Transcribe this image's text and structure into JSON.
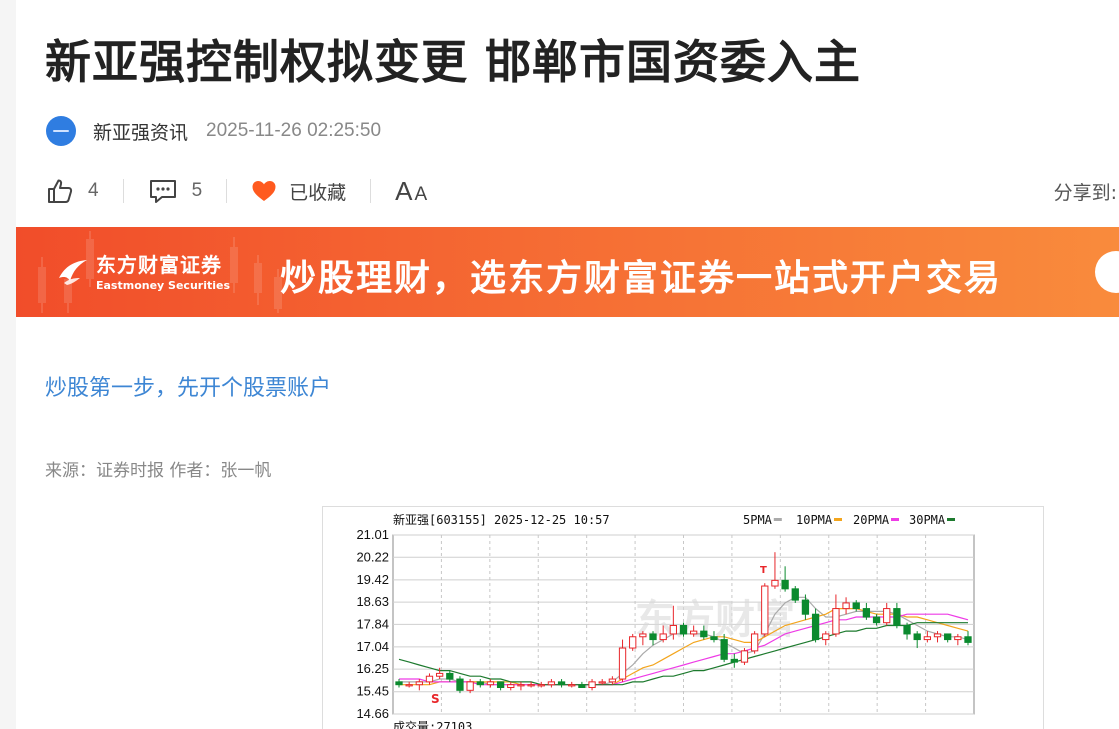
{
  "article": {
    "title": "新亚强控制权拟变更 邯郸市国资委入主",
    "source_name": "新亚强资讯",
    "publish_time": "2025-11-26 02:25:50",
    "like_count": "4",
    "comment_count": "5",
    "favorite_label": "已收藏",
    "font_size_big": "A",
    "font_size_small": "A",
    "share_label": "分享到:",
    "promo_link": "炒股第一步，先开个股票账户",
    "origin": "来源：证券时报 作者：张一帆"
  },
  "banner": {
    "brand_cn": "东方财富证券",
    "brand_en": "Eastmoney Securities",
    "slogan": "炒股理财，选东方财富证券一站式开户交易"
  },
  "colors": {
    "banner_start": "#f14d2a",
    "banner_end": "#f98b3c",
    "link": "#3d86d4",
    "favorite_heart": "#ff5a1f",
    "candle_up": "#e8262a",
    "candle_down": "#0b8a2e",
    "ma5": "#aaaaaa",
    "ma10": "#f3a51d",
    "ma20": "#ee3be6",
    "ma30": "#1d7a2e"
  },
  "icons": {
    "like": "thumbs-up-icon",
    "comment": "comment-icon",
    "favorite": "heart-icon"
  },
  "chart_data": {
    "type": "candlestick",
    "header": "新亚强[603155] 2025-12-25 10:57",
    "legend": [
      "5PMA",
      "10PMA",
      "20PMA",
      "30PMA"
    ],
    "y_ticks": [
      "21.01",
      "20.22",
      "19.42",
      "18.63",
      "17.84",
      "17.04",
      "16.25",
      "15.45",
      "14.66"
    ],
    "ylim": [
      14.66,
      21.01
    ],
    "footer": "成交量:27103",
    "candles": [
      [
        15.8,
        15.9,
        15.6,
        15.7
      ],
      [
        15.7,
        15.8,
        15.6,
        15.7
      ],
      [
        15.7,
        15.9,
        15.5,
        15.8
      ],
      [
        15.8,
        16.1,
        15.7,
        16.0
      ],
      [
        16.0,
        16.3,
        15.9,
        16.1
      ],
      [
        16.1,
        16.2,
        15.8,
        15.9
      ],
      [
        15.9,
        16.0,
        15.4,
        15.5
      ],
      [
        15.5,
        15.9,
        15.4,
        15.8
      ],
      [
        15.8,
        15.9,
        15.6,
        15.7
      ],
      [
        15.7,
        15.9,
        15.6,
        15.8
      ],
      [
        15.8,
        15.8,
        15.5,
        15.6
      ],
      [
        15.6,
        15.8,
        15.5,
        15.7
      ],
      [
        15.7,
        15.8,
        15.5,
        15.7
      ],
      [
        15.7,
        15.8,
        15.6,
        15.7
      ],
      [
        15.7,
        15.8,
        15.6,
        15.7
      ],
      [
        15.7,
        15.9,
        15.6,
        15.8
      ],
      [
        15.8,
        15.9,
        15.6,
        15.7
      ],
      [
        15.7,
        15.8,
        15.6,
        15.7
      ],
      [
        15.7,
        15.8,
        15.6,
        15.6
      ],
      [
        15.6,
        15.9,
        15.5,
        15.8
      ],
      [
        15.8,
        15.9,
        15.7,
        15.8
      ],
      [
        15.8,
        16.0,
        15.7,
        15.9
      ],
      [
        15.9,
        17.3,
        15.8,
        17.0
      ],
      [
        17.0,
        17.5,
        16.9,
        17.4
      ],
      [
        17.4,
        17.6,
        17.1,
        17.5
      ],
      [
        17.5,
        17.6,
        17.1,
        17.3
      ],
      [
        17.3,
        17.8,
        17.2,
        17.5
      ],
      [
        17.5,
        18.5,
        17.3,
        17.8
      ],
      [
        17.8,
        17.9,
        17.4,
        17.5
      ],
      [
        17.5,
        17.8,
        17.4,
        17.6
      ],
      [
        17.6,
        17.8,
        17.3,
        17.4
      ],
      [
        17.4,
        17.6,
        17.2,
        17.3
      ],
      [
        17.3,
        17.5,
        16.5,
        16.6
      ],
      [
        16.6,
        16.8,
        16.3,
        16.5
      ],
      [
        16.5,
        17.0,
        16.4,
        16.9
      ],
      [
        16.9,
        17.6,
        16.8,
        17.5
      ],
      [
        17.5,
        19.3,
        17.4,
        19.2
      ],
      [
        19.2,
        20.4,
        19.1,
        19.4
      ],
      [
        19.4,
        19.9,
        19.0,
        19.1
      ],
      [
        19.1,
        19.2,
        18.6,
        18.7
      ],
      [
        18.7,
        18.9,
        18.0,
        18.2
      ],
      [
        18.2,
        18.4,
        17.2,
        17.3
      ],
      [
        17.3,
        17.6,
        17.1,
        17.5
      ],
      [
        17.5,
        18.9,
        17.4,
        18.4
      ],
      [
        18.4,
        18.8,
        18.2,
        18.6
      ],
      [
        18.6,
        18.7,
        18.3,
        18.4
      ],
      [
        18.4,
        18.6,
        18.0,
        18.1
      ],
      [
        18.1,
        18.2,
        17.8,
        17.9
      ],
      [
        17.9,
        18.6,
        17.8,
        18.4
      ],
      [
        18.4,
        18.6,
        17.7,
        17.8
      ],
      [
        17.8,
        17.9,
        17.3,
        17.5
      ],
      [
        17.5,
        17.6,
        17.0,
        17.3
      ],
      [
        17.3,
        17.6,
        17.2,
        17.4
      ],
      [
        17.4,
        17.6,
        17.2,
        17.5
      ],
      [
        17.5,
        17.5,
        17.2,
        17.3
      ],
      [
        17.3,
        17.5,
        17.1,
        17.4
      ],
      [
        17.4,
        17.6,
        17.1,
        17.2
      ]
    ],
    "ma": {
      "5PMA": [
        15.8,
        15.8,
        15.8,
        15.8,
        15.9,
        15.9,
        15.8,
        15.8,
        15.8,
        15.7,
        15.7,
        15.7,
        15.7,
        15.7,
        15.7,
        15.7,
        15.7,
        15.7,
        15.7,
        15.7,
        15.7,
        15.8,
        16.1,
        16.4,
        16.8,
        17.1,
        17.3,
        17.5,
        17.5,
        17.5,
        17.5,
        17.4,
        17.2,
        17.0,
        16.8,
        16.9,
        17.5,
        18.2,
        18.6,
        18.8,
        18.8,
        18.4,
        18.1,
        18.1,
        18.2,
        18.3,
        18.3,
        18.3,
        18.3,
        18.2,
        18.0,
        17.8,
        17.6,
        17.5,
        17.4,
        17.4,
        17.3
      ],
      "10PMA": [
        15.7,
        15.7,
        15.7,
        15.7,
        15.8,
        15.8,
        15.8,
        15.8,
        15.8,
        15.8,
        15.8,
        15.8,
        15.7,
        15.7,
        15.7,
        15.7,
        15.7,
        15.7,
        15.7,
        15.7,
        15.7,
        15.7,
        15.9,
        16.1,
        16.3,
        16.4,
        16.6,
        16.8,
        17.0,
        17.2,
        17.3,
        17.4,
        17.4,
        17.3,
        17.2,
        17.2,
        17.4,
        17.6,
        17.8,
        17.9,
        18.0,
        18.1,
        18.2,
        18.4,
        18.4,
        18.4,
        18.3,
        18.2,
        18.2,
        18.2,
        18.1,
        18.1,
        18.0,
        17.9,
        17.8,
        17.7,
        17.6
      ],
      "20PMA": [
        15.9,
        15.9,
        15.9,
        15.8,
        15.8,
        15.8,
        15.8,
        15.8,
        15.7,
        15.7,
        15.7,
        15.7,
        15.7,
        15.7,
        15.7,
        15.7,
        15.7,
        15.7,
        15.7,
        15.7,
        15.7,
        15.7,
        15.8,
        15.9,
        16.0,
        16.1,
        16.2,
        16.3,
        16.4,
        16.5,
        16.6,
        16.7,
        16.8,
        16.8,
        16.9,
        17.0,
        17.1,
        17.3,
        17.5,
        17.6,
        17.7,
        17.8,
        17.9,
        18.0,
        18.0,
        18.1,
        18.1,
        18.1,
        18.1,
        18.1,
        18.2,
        18.2,
        18.2,
        18.2,
        18.2,
        18.1,
        18.0
      ],
      "30PMA": [
        16.6,
        16.5,
        16.4,
        16.3,
        16.2,
        16.2,
        16.1,
        16.0,
        16.0,
        15.9,
        15.9,
        15.8,
        15.8,
        15.8,
        15.7,
        15.7,
        15.7,
        15.7,
        15.7,
        15.7,
        15.7,
        15.7,
        15.7,
        15.8,
        15.8,
        15.9,
        16.0,
        16.0,
        16.1,
        16.2,
        16.2,
        16.3,
        16.4,
        16.5,
        16.6,
        16.7,
        16.8,
        16.9,
        17.0,
        17.1,
        17.2,
        17.3,
        17.4,
        17.5,
        17.6,
        17.6,
        17.7,
        17.7,
        17.8,
        17.8,
        17.8,
        17.9,
        17.9,
        17.9,
        17.9,
        17.9,
        17.9
      ]
    }
  }
}
